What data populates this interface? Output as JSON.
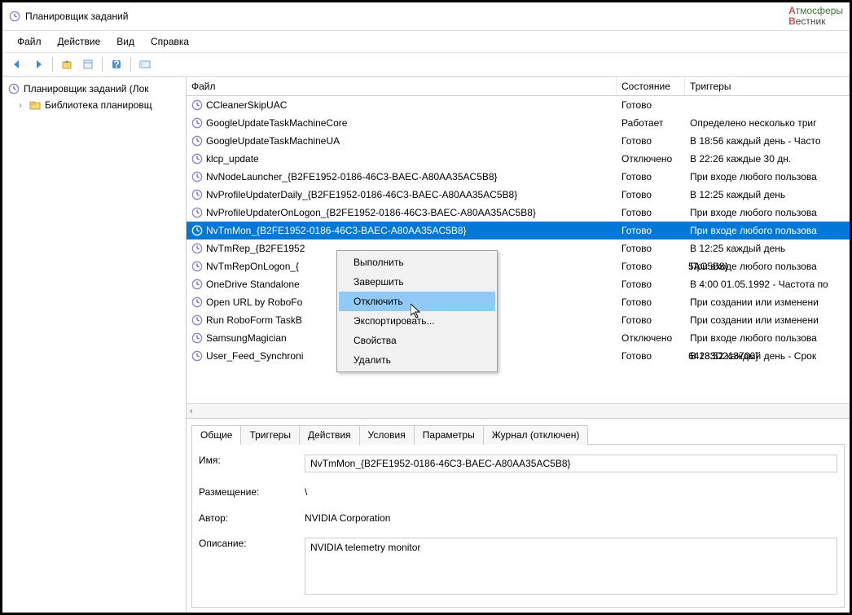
{
  "window": {
    "title": "Планировщик заданий"
  },
  "menu": [
    "Файл",
    "Действие",
    "Вид",
    "Справка"
  ],
  "tree": {
    "root": "Планировщик заданий (Лок",
    "child": "Библиотека планировщ"
  },
  "columns": {
    "file": "Файл",
    "status": "Состояние",
    "trigger": "Триггеры"
  },
  "tasks": [
    {
      "name": "CCleanerSkipUAC",
      "status": "Готово",
      "trigger": ""
    },
    {
      "name": "GoogleUpdateTaskMachineCore",
      "status": "Работает",
      "trigger": "Определено несколько триг"
    },
    {
      "name": "GoogleUpdateTaskMachineUA",
      "status": "Готово",
      "trigger": "В 18:56 каждый день - Часто"
    },
    {
      "name": "klcp_update",
      "status": "Отключено",
      "trigger": "В 22:26 каждые 30 дн."
    },
    {
      "name": "NvNodeLauncher_{B2FE1952-0186-46C3-BAEC-A80AA35AC5B8}",
      "status": "Готово",
      "trigger": "При входе любого пользова"
    },
    {
      "name": "NvProfileUpdaterDaily_{B2FE1952-0186-46C3-BAEC-A80AA35AC5B8}",
      "status": "Готово",
      "trigger": "В 12:25 каждый день"
    },
    {
      "name": "NvProfileUpdaterOnLogon_{B2FE1952-0186-46C3-BAEC-A80AA35AC5B8}",
      "status": "Готово",
      "trigger": "При входе любого пользова"
    },
    {
      "name": "NvTmMon_{B2FE1952-0186-46C3-BAEC-A80AA35AC5B8}",
      "status": "Готово",
      "trigger": "При входе любого пользова",
      "selected": true
    },
    {
      "name": "NvTmRep_{B2FE1952",
      "status": "Готово",
      "trigger": "В 12:25 каждый день"
    },
    {
      "name": "NvTmRepOnLogon_{",
      "status_suffix": "5AC5B8}",
      "status": "Готово",
      "trigger": "При входе любого пользова"
    },
    {
      "name": "OneDrive Standalone",
      "status": "Готово",
      "trigger": "В 4:00 01.05.1992 - Частота по"
    },
    {
      "name": "Open URL by RoboFo",
      "status": "Готово",
      "trigger": "При создании или изменени"
    },
    {
      "name": "Run RoboForm TaskB",
      "status": "Готово",
      "trigger": "При создании или изменени"
    },
    {
      "name": "SamsungMagician",
      "status": "Отключено",
      "trigger": "При входе любого пользова"
    },
    {
      "name": "User_Feed_Synchroni",
      "status_suffix": "64183D213706}",
      "status": "Готово",
      "trigger": "В 23:52 каждый день - Срок"
    }
  ],
  "context_menu": {
    "items": [
      "Выполнить",
      "Завершить",
      "Отключить",
      "Экспортировать...",
      "Свойства",
      "Удалить"
    ],
    "hover_index": 2
  },
  "details": {
    "tabs": [
      "Общие",
      "Триггеры",
      "Действия",
      "Условия",
      "Параметры",
      "Журнал (отключен)"
    ],
    "active_tab": 0,
    "labels": {
      "name": "Имя:",
      "location": "Размещение:",
      "author": "Автор:",
      "description": "Описание:"
    },
    "values": {
      "name": "NvTmMon_{B2FE1952-0186-46C3-BAEC-A80AA35AC5B8}",
      "location": "\\",
      "author": "NVIDIA Corporation",
      "description": "NVIDIA telemetry monitor"
    }
  },
  "logo": {
    "a": "А",
    "a2": "тмосферы",
    "b": "В",
    "b2": "естник"
  }
}
